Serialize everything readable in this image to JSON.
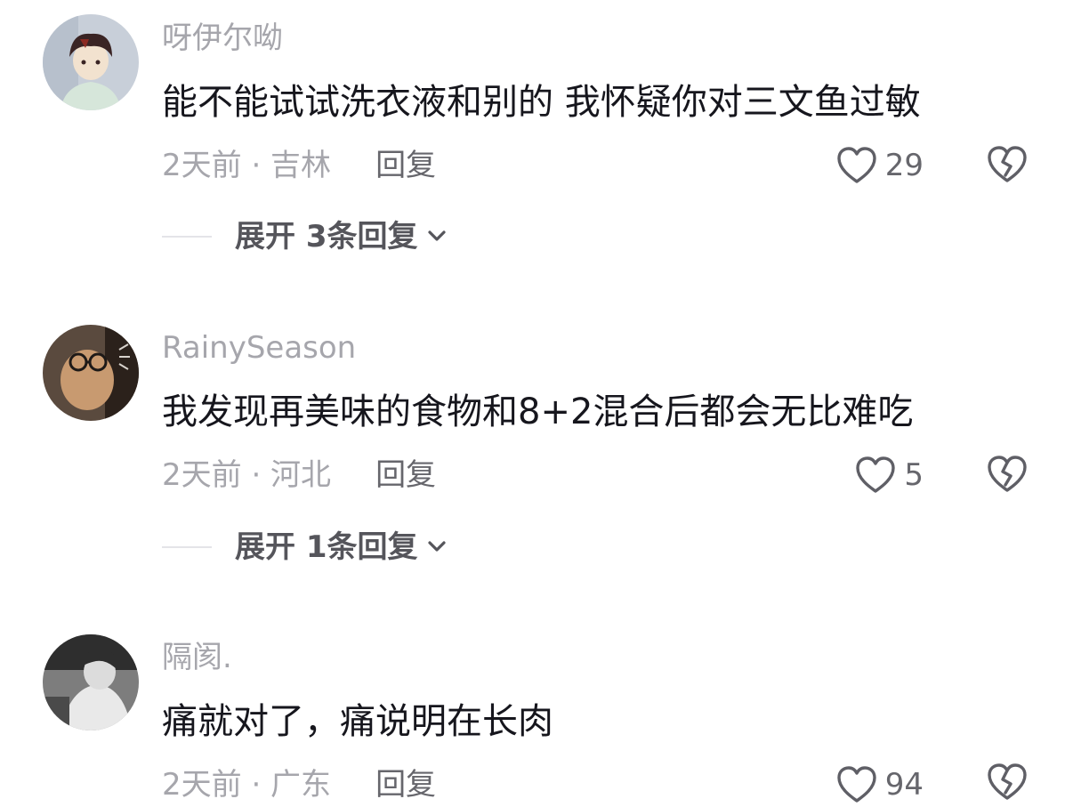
{
  "comments": [
    {
      "username": "呀伊尔呦",
      "content": "能不能试试洗衣液和别的 我怀疑你对三文鱼过敏",
      "meta": "2天前 · 吉林",
      "reply_label": "回复",
      "likes": "29",
      "expand_label": "展开 3条回复",
      "avatar_colors": {
        "bg": "#c8cfd9",
        "hair": "#3a2424",
        "skin": "#f2e2cf",
        "robe": "#d6e6da"
      }
    },
    {
      "username": "RainySeason",
      "content": "我发现再美味的食物和8+2混合后都会无比难吃",
      "meta": "2天前 · 河北",
      "reply_label": "回复",
      "likes": "5",
      "expand_label": "展开 1条回复",
      "avatar_colors": {
        "bg": "#5a4a3e",
        "fur": "#c89a70",
        "dark": "#2b211b"
      }
    },
    {
      "username": "隔阂.",
      "content": "痛就对了，痛说明在长肉",
      "meta": "2天前 · 广东",
      "reply_label": "回复",
      "likes": "94",
      "avatar_colors": {
        "bg": "#7d7d7d",
        "light": "#e9e9e9",
        "dark": "#2e2e2e"
      }
    }
  ],
  "colors": {
    "name_gray": "#a6a6ac",
    "text_dark": "#16161d",
    "reply_gray": "#66666c",
    "icon_gray": "#5f5f66"
  },
  "icons": {
    "like": "heart-outline-icon",
    "dislike": "broken-heart-icon",
    "expand": "chevron-down-icon"
  }
}
